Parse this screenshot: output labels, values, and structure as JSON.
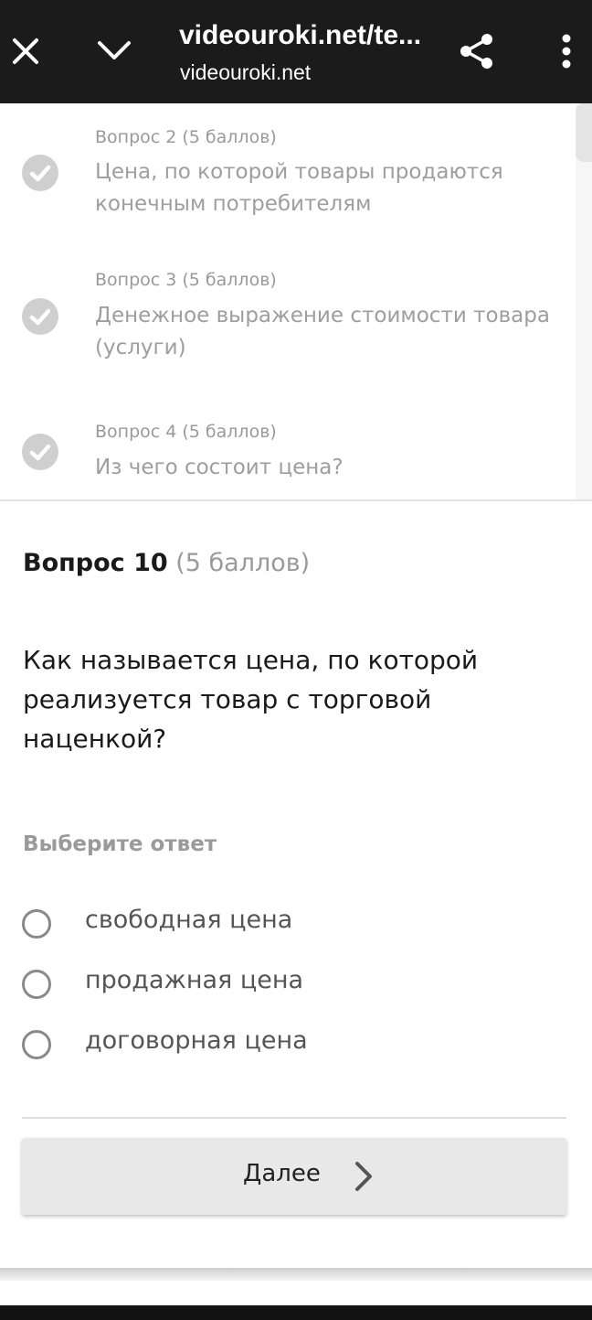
{
  "browser": {
    "url_title": "videouroki.net/te...",
    "url_domain": "videouroki.net",
    "icons": [
      "close-icon",
      "chevron-down-icon",
      "share-icon",
      "more-vertical-icon"
    ]
  },
  "answered": [
    {
      "header": "Вопрос 2 (5 баллов)",
      "text": "Цена, по которой товары продаются конечным потребителям"
    },
    {
      "header": "Вопрос 3 (5 баллов)",
      "text": "Денежное выражение стоимости товара (услуги)"
    },
    {
      "header": "Вопрос 4 (5 баллов)",
      "text": "Из чего состоит цена?"
    }
  ],
  "question": {
    "number_label": "Вопрос 10",
    "points_label": "(5 баллов)",
    "text": "Как называется цена, по которой реализуется товар с торговой наценкой?",
    "choose_label": "Выберите ответ",
    "options": [
      "свободная цена",
      "продажная цена",
      "договорная цена"
    ]
  },
  "next_button": {
    "label": "Далее"
  },
  "colors": {
    "topbar": "#1b1b1b",
    "check": "#cfcfcf",
    "muted_text": "#9a9a9a",
    "button_bg": "#e8e8e8"
  }
}
